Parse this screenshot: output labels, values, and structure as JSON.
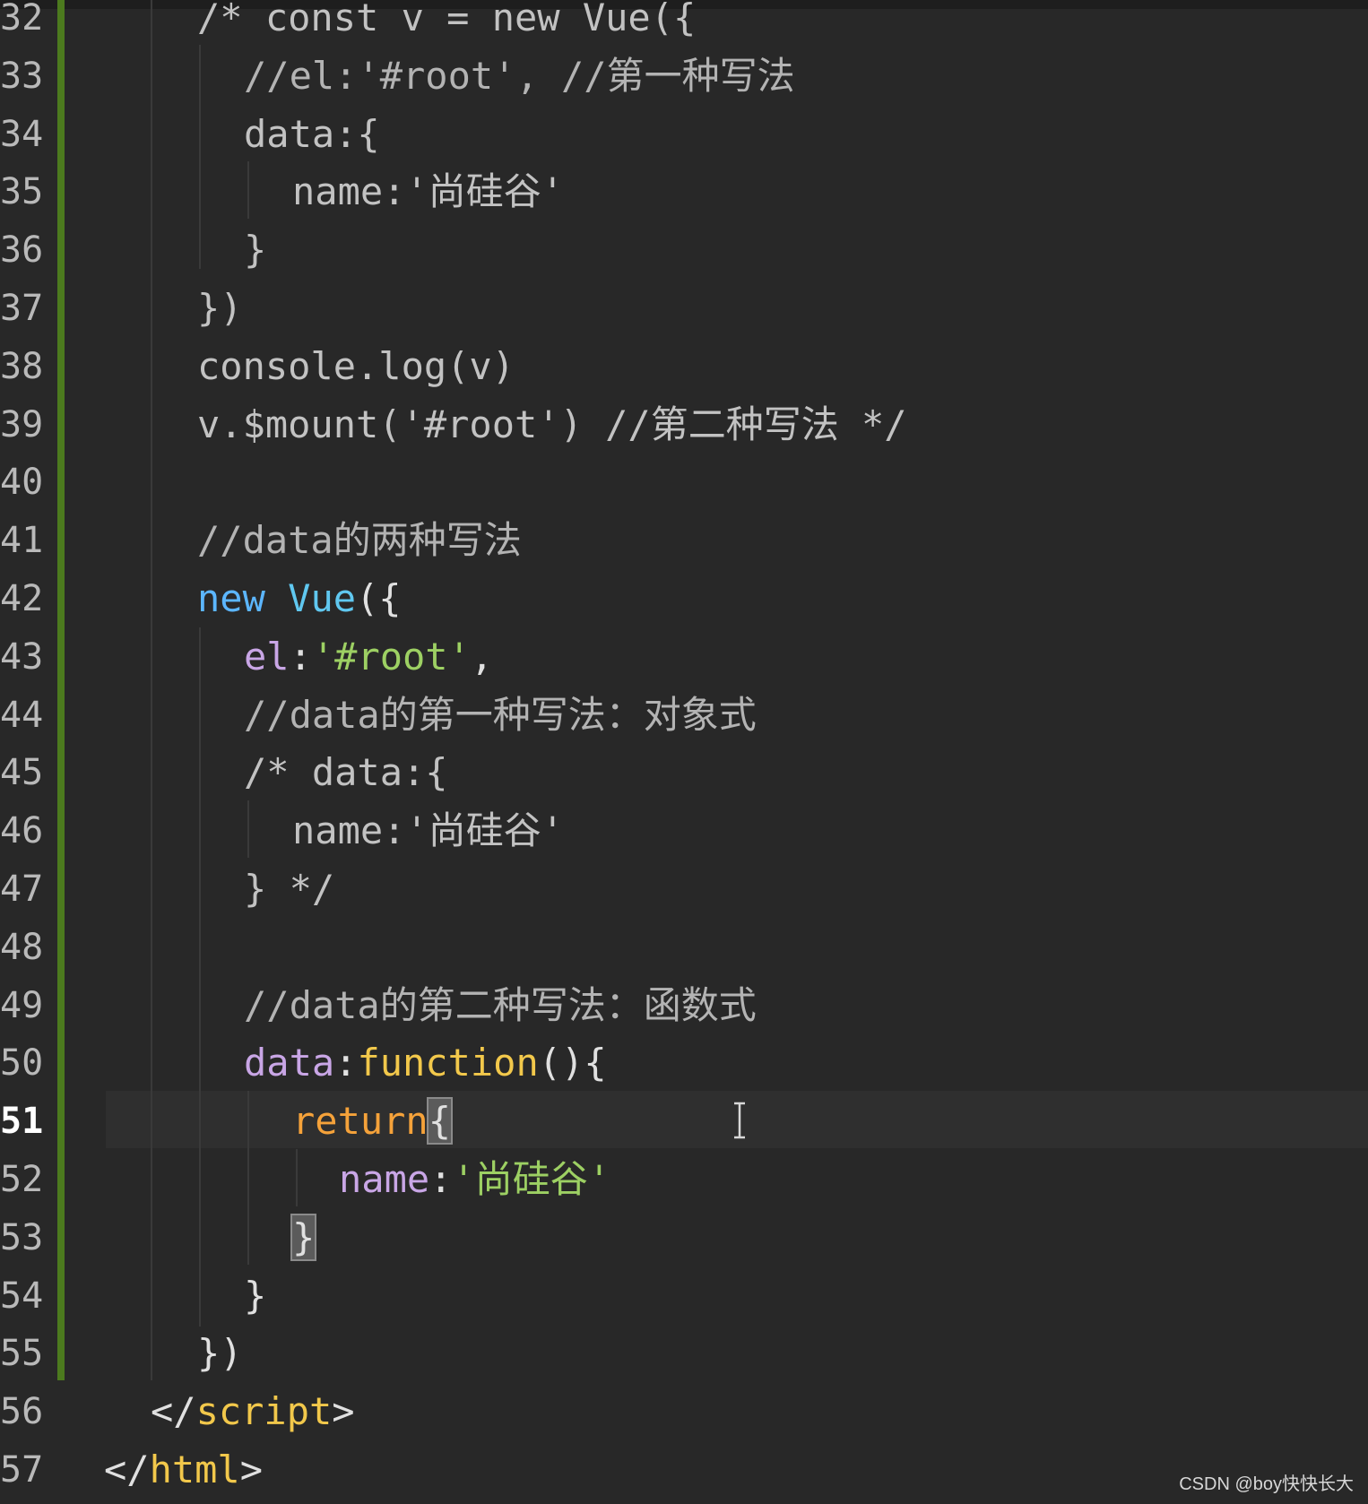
{
  "editor": {
    "lines": [
      {
        "num": "32",
        "tokens": [
          {
            "t": "/* const v = new Vue({",
            "c": "c-dim"
          }
        ]
      },
      {
        "num": "33",
        "tokens": [
          {
            "t": "//el:'#root', //第一种写法",
            "c": "c-comment"
          }
        ]
      },
      {
        "num": "34",
        "tokens": [
          {
            "t": "data:{",
            "c": "c-dim"
          }
        ]
      },
      {
        "num": "35",
        "tokens": [
          {
            "t": "name:'尚硅谷'",
            "c": "c-dim"
          }
        ]
      },
      {
        "num": "36",
        "tokens": [
          {
            "t": "}",
            "c": "c-dim"
          }
        ]
      },
      {
        "num": "37",
        "tokens": [
          {
            "t": "})",
            "c": "c-dim"
          }
        ]
      },
      {
        "num": "38",
        "tokens": [
          {
            "t": "console.log(v)",
            "c": "c-dim"
          }
        ]
      },
      {
        "num": "39",
        "tokens": [
          {
            "t": "v.$mount('#root') //第二种写法 */",
            "c": "c-dim"
          }
        ]
      },
      {
        "num": "40",
        "tokens": []
      },
      {
        "num": "41",
        "tokens": [
          {
            "t": "//data的两种写法",
            "c": "c-comment"
          }
        ]
      },
      {
        "num": "42",
        "tokens": [
          {
            "t": "new",
            "c": "c-kw"
          },
          {
            "t": " ",
            "c": "c-plain"
          },
          {
            "t": "Vue",
            "c": "c-class"
          },
          {
            "t": "({",
            "c": "c-punc"
          }
        ]
      },
      {
        "num": "43",
        "tokens": [
          {
            "t": "el",
            "c": "c-prop"
          },
          {
            "t": ":",
            "c": "c-punc"
          },
          {
            "t": "'#root'",
            "c": "c-str"
          },
          {
            "t": ",",
            "c": "c-punc"
          }
        ]
      },
      {
        "num": "44",
        "tokens": [
          {
            "t": "//data的第一种写法：对象式",
            "c": "c-comment"
          }
        ]
      },
      {
        "num": "45",
        "tokens": [
          {
            "t": "/* data:{",
            "c": "c-dim"
          }
        ]
      },
      {
        "num": "46",
        "tokens": [
          {
            "t": "name:'尚硅谷'",
            "c": "c-dim"
          }
        ]
      },
      {
        "num": "47",
        "tokens": [
          {
            "t": "} */",
            "c": "c-dim"
          }
        ]
      },
      {
        "num": "48",
        "tokens": []
      },
      {
        "num": "49",
        "tokens": [
          {
            "t": "//data的第二种写法：函数式",
            "c": "c-comment"
          }
        ]
      },
      {
        "num": "50",
        "tokens": [
          {
            "t": "data",
            "c": "c-prop"
          },
          {
            "t": ":",
            "c": "c-punc"
          },
          {
            "t": "function",
            "c": "c-func"
          },
          {
            "t": "(){",
            "c": "c-punc"
          }
        ]
      },
      {
        "num": "51",
        "tokens": [
          {
            "t": "return",
            "c": "c-ret"
          },
          {
            "t": "{",
            "c": "c-punc bracket-match"
          }
        ]
      },
      {
        "num": "52",
        "tokens": [
          {
            "t": "name",
            "c": "c-prop"
          },
          {
            "t": ":",
            "c": "c-punc"
          },
          {
            "t": "'尚硅谷'",
            "c": "c-str"
          }
        ]
      },
      {
        "num": "53",
        "tokens": [
          {
            "t": "}",
            "c": "c-punc bracket-match"
          }
        ]
      },
      {
        "num": "54",
        "tokens": [
          {
            "t": "}",
            "c": "c-punc"
          }
        ]
      },
      {
        "num": "55",
        "tokens": [
          {
            "t": "})",
            "c": "c-punc"
          }
        ]
      },
      {
        "num": "56",
        "tokens": [
          {
            "t": "</",
            "c": "c-tag"
          },
          {
            "t": "script",
            "c": "c-tagname"
          },
          {
            "t": ">",
            "c": "c-tag"
          }
        ]
      },
      {
        "num": "57",
        "tokens": [
          {
            "t": "</",
            "c": "c-tag"
          },
          {
            "t": "html",
            "c": "c-tagname"
          },
          {
            "t": ">",
            "c": "c-tag"
          }
        ]
      }
    ],
    "active_line": "51"
  },
  "watermark": {
    "text": "CSDN @boy快快长大"
  },
  "colors": {
    "background": "#282828",
    "gutter_bar": "#4c7a1e",
    "keyword": "#5cb6ff",
    "string": "#9dd063",
    "property": "#c9a6e6",
    "function": "#f2c84b",
    "return": "#f5a23a"
  }
}
